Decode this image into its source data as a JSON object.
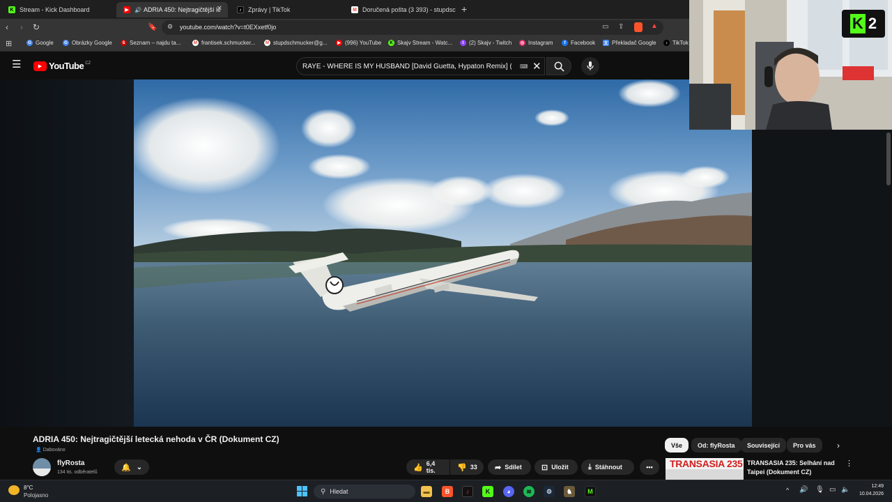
{
  "browser": {
    "tabs": [
      {
        "label": "Stream - Kick Dashboard",
        "icon": "kick-icon",
        "color": "#53fc18",
        "active": false
      },
      {
        "label": "ADRIA 450: Nejtragičtější leté",
        "icon": "youtube-icon",
        "color": "#ff0000",
        "active": true
      },
      {
        "label": "Zprávy | TikTok",
        "icon": "tiktok-icon",
        "color": "#ffffff",
        "active": false
      },
      {
        "label": "Doručená pošta (3 393) - stupdschm",
        "icon": "gmail-icon",
        "color": "#ea4335",
        "active": false
      }
    ],
    "url": "youtube.com/watch?v=t0EXxetf0jo",
    "bookmarks": [
      {
        "label": "Google",
        "color": "#4285f4"
      },
      {
        "label": "Obrázky Google",
        "color": "#4285f4"
      },
      {
        "label": "Seznam – najdu ta...",
        "color": "#cc0000"
      },
      {
        "label": "frantisek.schmucker...",
        "color": "#ea4335"
      },
      {
        "label": "stupdschmucker@g...",
        "color": "#ea4335"
      },
      {
        "label": "(996) YouTube",
        "color": "#ff0000"
      },
      {
        "label": "Skajv Stream - Watc...",
        "color": "#53fc18"
      },
      {
        "label": "(2) Skajv - Twitch",
        "color": "#9146ff"
      },
      {
        "label": "Instagram",
        "color": "#e1306c"
      },
      {
        "label": "Facebook",
        "color": "#1877f2"
      },
      {
        "label": "Překladač Google",
        "color": "#4285f4"
      },
      {
        "label": "TikTok",
        "color": "#ffffff"
      }
    ]
  },
  "youtube": {
    "logo": "YouTube",
    "region": "CZ",
    "search_query": "RAYE - WHERE IS MY HUSBAND [David Guetta, Hypaton Remix] (C",
    "video_title": "ADRIA 450: Nejtragičtější letecká nehoda v ČR (Dokument CZ)",
    "dubbed_label": "Dabováno",
    "channel": {
      "name": "flyRosta",
      "subscribers": "134 tis. odběratelů"
    },
    "actions": {
      "likes": "6,4 tis.",
      "dislikes": "33",
      "share": "Sdílet",
      "save": "Uložit",
      "download": "Stáhnout"
    },
    "chips": [
      "Vše",
      "Od: flyRosta",
      "Související",
      "Pro vás"
    ],
    "recommended": {
      "title": "TRANSASIA 235: Selhání nad Taipei (Dokument CZ)",
      "thumb_text": "TRANSASIA 235"
    }
  },
  "webcam": {
    "badge": "2"
  },
  "taskbar": {
    "weather_temp": "8°C",
    "weather_desc": "Polojasno",
    "search_placeholder": "Hledat",
    "time": "12:49",
    "date": "10.04.2026"
  }
}
